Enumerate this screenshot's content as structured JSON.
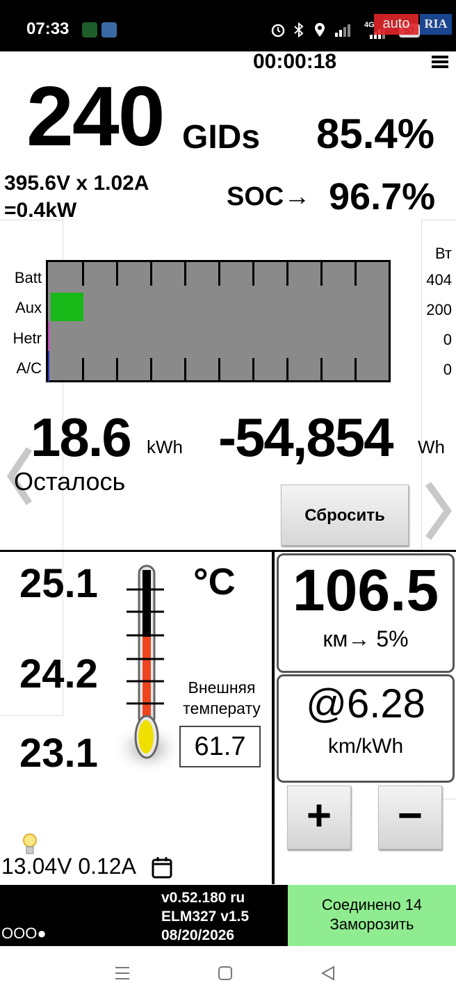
{
  "status_bar": {
    "time": "07:33",
    "battery": "57",
    "network": "4G",
    "watermark_left": "auto",
    "watermark_right": "RIA"
  },
  "header": {
    "timer": "00:00:18"
  },
  "battery": {
    "gids": "240",
    "gids_unit": "GIDs",
    "gids_percent": "85.4%",
    "voltage_current": "395.6V x 1.02A",
    "power": "=0.4kW",
    "soc_label": "SOC→",
    "soc_value": "96.7%"
  },
  "power_bars": {
    "unit": "Вт",
    "rows": [
      {
        "label": "Batt",
        "value": "404",
        "fraction": 0.0
      },
      {
        "label": "Aux",
        "value": "200",
        "fraction": 0.1
      },
      {
        "label": "Hetr",
        "value": "0",
        "fraction": 0.0
      },
      {
        "label": "A/C",
        "value": "0",
        "fraction": 0.0
      }
    ],
    "colors": {
      "background": "#8a8a8a",
      "aux": "#18b818"
    }
  },
  "energy": {
    "remaining_value": "18.6",
    "remaining_unit": "kWh",
    "used_value": "-54,854",
    "used_unit": "Wh",
    "remaining_label": "Осталось",
    "reset_label": "Сбросить"
  },
  "temperature": {
    "values": [
      "25.1",
      "24.2",
      "23.1"
    ],
    "unit": "°C",
    "external_label_line1": "Внешняя",
    "external_label_line2": "температу",
    "external_value": "61.7"
  },
  "aux_battery": {
    "text": "13.04V 0.12A"
  },
  "range": {
    "value": "106.5",
    "sub": "км→ 5%"
  },
  "efficiency": {
    "value": "@6.28",
    "unit": "km/kWh",
    "plus_label": "+",
    "minus_label": "−"
  },
  "footer": {
    "dots": "OOO●",
    "version_line1": "v0.52.180 ru",
    "version_line2": "ELM327 v1.5",
    "version_line3": "08/20/2026",
    "status_line1": "Соединено 14",
    "status_line2": "Заморозить"
  }
}
